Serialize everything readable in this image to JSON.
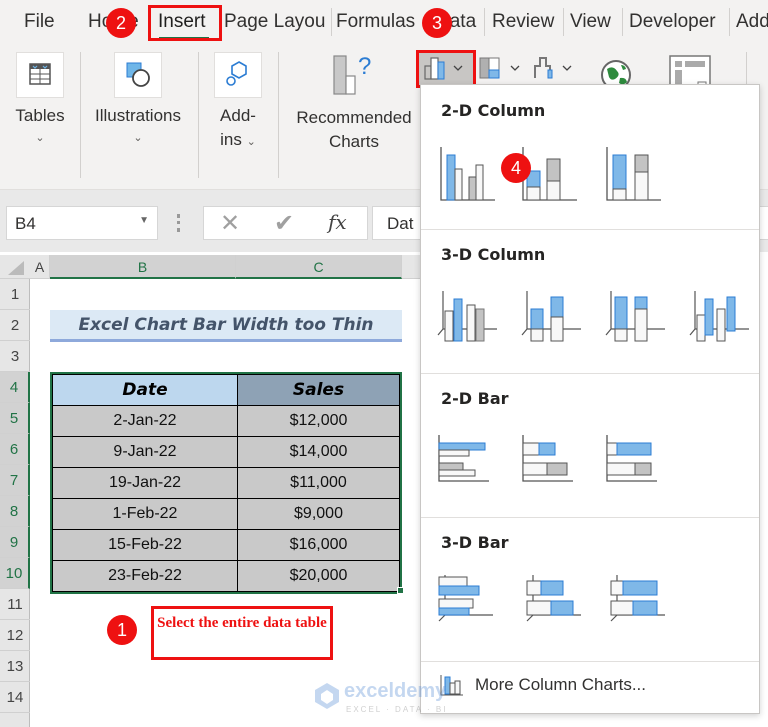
{
  "ribbon": {
    "tabs": [
      {
        "label": "File"
      },
      {
        "label": "Home"
      },
      {
        "label": "Insert",
        "active": true
      },
      {
        "label": "Page Layou"
      },
      {
        "label": "Formulas"
      },
      {
        "label": "Data"
      },
      {
        "label": "Review"
      },
      {
        "label": "View"
      },
      {
        "label": "Developer"
      },
      {
        "label": "Add"
      }
    ],
    "groups": {
      "tables": "Tables",
      "illustrations": "Illustrations",
      "addins_line1": "Add-",
      "addins_line2": "ins",
      "recommended_line1": "Recommended",
      "recommended_line2": "Charts"
    }
  },
  "formula_bar": {
    "name_box": "B4",
    "formula_value": "Dat",
    "fx_label": "fx"
  },
  "sheet": {
    "columns": [
      "A",
      "B",
      "C"
    ],
    "rows": [
      "1",
      "2",
      "3",
      "4",
      "5",
      "6",
      "7",
      "8",
      "9",
      "10",
      "11",
      "12",
      "13",
      "14"
    ],
    "title": "Excel Chart Bar Width too Thin",
    "table": {
      "headers": [
        "Date",
        "Sales"
      ],
      "rows": [
        [
          "2-Jan-22",
          "$12,000"
        ],
        [
          "9-Jan-22",
          "$14,000"
        ],
        [
          "19-Jan-22",
          "$11,000"
        ],
        [
          "1-Feb-22",
          "$9,000"
        ],
        [
          "15-Feb-22",
          "$16,000"
        ],
        [
          "23-Feb-22",
          "$20,000"
        ]
      ]
    }
  },
  "annotations": {
    "step1": "1",
    "step2": "2",
    "step3": "3",
    "step4": "4",
    "note": "Select the entire data table"
  },
  "dropdown": {
    "sections": [
      {
        "heading": "2-D Column"
      },
      {
        "heading": "3-D Column"
      },
      {
        "heading": "2-D Bar"
      },
      {
        "heading": "3-D Bar"
      }
    ],
    "more_label": "More Column Charts..."
  },
  "watermark": {
    "brand": "exceldemy",
    "tagline": "EXCEL · DATA · BI"
  },
  "colors": {
    "accent_red": "#ee1111",
    "excel_green": "#217346",
    "chart_blue": "#7fb8e8"
  }
}
